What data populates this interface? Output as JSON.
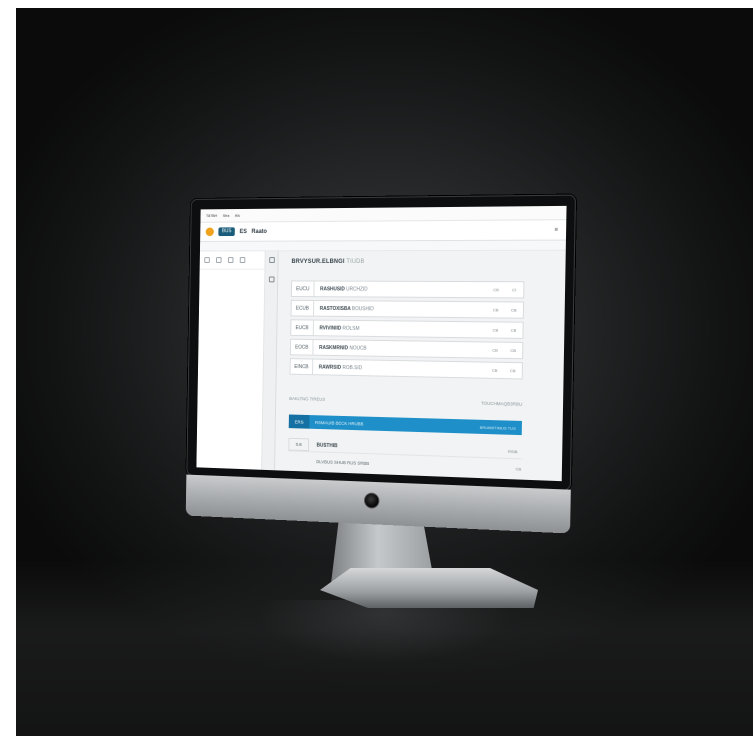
{
  "topbar": {
    "items": [
      "T87BH",
      "Stra",
      "Als"
    ]
  },
  "toolbar": {
    "badge": "BUS",
    "tab": "ES",
    "title": "Raato",
    "menu": "≡"
  },
  "main": {
    "title": "BRVYSUR.ELBNGI",
    "title_muted": "TIUDB",
    "rows": [
      {
        "code": "EUCU",
        "label": "RASHUSID",
        "label_lite": "URCHZID",
        "act1": "CB",
        "act2": "CI"
      },
      {
        "code": "ECUB",
        "label": "RASTOXISBA",
        "label_lite": "BOUSHID",
        "act1": "CB",
        "act2": "CB"
      },
      {
        "code": "EUCB",
        "label": "RVIVINIID",
        "label_lite": "ROLSM",
        "act1": "CB",
        "act2": "CB"
      },
      {
        "code": "EOCB",
        "label": "RASKMRNID",
        "label_lite": "NOUCB",
        "act1": "CB",
        "act2": "CB"
      },
      {
        "code": "EINCB",
        "label": "RAWRSID",
        "label_lite": "ROB.SID",
        "act1": "CB",
        "act2": "CB"
      }
    ],
    "summary_left": "BAKLTNG TIREUS",
    "summary_right": "TOUCHMAQB3RBU",
    "blue_code": "ERS",
    "blue_label": "RSMAUIB BECK HRUBB",
    "blue_right": "BRUMBTIMUS TUS",
    "foot_code": "0.8",
    "foot_label": "BUSTHIB",
    "foot_right": "RSIB",
    "foot2_label": "DLVBUS SHUB RUS SRBB",
    "foot2_right": "CB"
  }
}
